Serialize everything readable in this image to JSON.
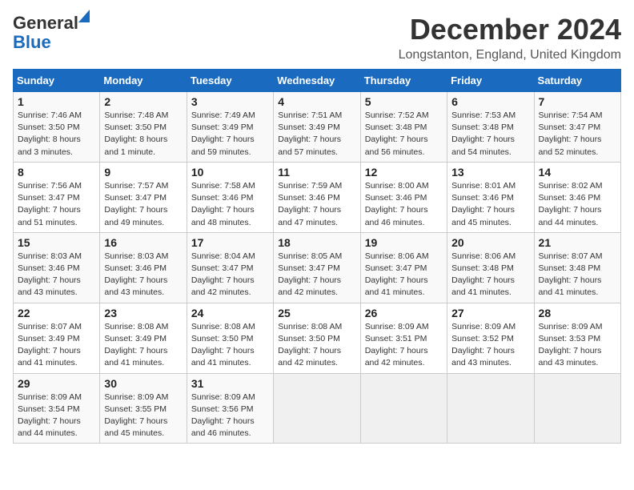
{
  "logo": {
    "line1": "General",
    "line2": "Blue"
  },
  "title": "December 2024",
  "subtitle": "Longstanton, England, United Kingdom",
  "headers": [
    "Sunday",
    "Monday",
    "Tuesday",
    "Wednesday",
    "Thursday",
    "Friday",
    "Saturday"
  ],
  "weeks": [
    [
      {
        "day": "1",
        "info": "Sunrise: 7:46 AM\nSunset: 3:50 PM\nDaylight: 8 hours\nand 3 minutes."
      },
      {
        "day": "2",
        "info": "Sunrise: 7:48 AM\nSunset: 3:50 PM\nDaylight: 8 hours\nand 1 minute."
      },
      {
        "day": "3",
        "info": "Sunrise: 7:49 AM\nSunset: 3:49 PM\nDaylight: 7 hours\nand 59 minutes."
      },
      {
        "day": "4",
        "info": "Sunrise: 7:51 AM\nSunset: 3:49 PM\nDaylight: 7 hours\nand 57 minutes."
      },
      {
        "day": "5",
        "info": "Sunrise: 7:52 AM\nSunset: 3:48 PM\nDaylight: 7 hours\nand 56 minutes."
      },
      {
        "day": "6",
        "info": "Sunrise: 7:53 AM\nSunset: 3:48 PM\nDaylight: 7 hours\nand 54 minutes."
      },
      {
        "day": "7",
        "info": "Sunrise: 7:54 AM\nSunset: 3:47 PM\nDaylight: 7 hours\nand 52 minutes."
      }
    ],
    [
      {
        "day": "8",
        "info": "Sunrise: 7:56 AM\nSunset: 3:47 PM\nDaylight: 7 hours\nand 51 minutes."
      },
      {
        "day": "9",
        "info": "Sunrise: 7:57 AM\nSunset: 3:47 PM\nDaylight: 7 hours\nand 49 minutes."
      },
      {
        "day": "10",
        "info": "Sunrise: 7:58 AM\nSunset: 3:46 PM\nDaylight: 7 hours\nand 48 minutes."
      },
      {
        "day": "11",
        "info": "Sunrise: 7:59 AM\nSunset: 3:46 PM\nDaylight: 7 hours\nand 47 minutes."
      },
      {
        "day": "12",
        "info": "Sunrise: 8:00 AM\nSunset: 3:46 PM\nDaylight: 7 hours\nand 46 minutes."
      },
      {
        "day": "13",
        "info": "Sunrise: 8:01 AM\nSunset: 3:46 PM\nDaylight: 7 hours\nand 45 minutes."
      },
      {
        "day": "14",
        "info": "Sunrise: 8:02 AM\nSunset: 3:46 PM\nDaylight: 7 hours\nand 44 minutes."
      }
    ],
    [
      {
        "day": "15",
        "info": "Sunrise: 8:03 AM\nSunset: 3:46 PM\nDaylight: 7 hours\nand 43 minutes."
      },
      {
        "day": "16",
        "info": "Sunrise: 8:03 AM\nSunset: 3:46 PM\nDaylight: 7 hours\nand 43 minutes."
      },
      {
        "day": "17",
        "info": "Sunrise: 8:04 AM\nSunset: 3:47 PM\nDaylight: 7 hours\nand 42 minutes."
      },
      {
        "day": "18",
        "info": "Sunrise: 8:05 AM\nSunset: 3:47 PM\nDaylight: 7 hours\nand 42 minutes."
      },
      {
        "day": "19",
        "info": "Sunrise: 8:06 AM\nSunset: 3:47 PM\nDaylight: 7 hours\nand 41 minutes."
      },
      {
        "day": "20",
        "info": "Sunrise: 8:06 AM\nSunset: 3:48 PM\nDaylight: 7 hours\nand 41 minutes."
      },
      {
        "day": "21",
        "info": "Sunrise: 8:07 AM\nSunset: 3:48 PM\nDaylight: 7 hours\nand 41 minutes."
      }
    ],
    [
      {
        "day": "22",
        "info": "Sunrise: 8:07 AM\nSunset: 3:49 PM\nDaylight: 7 hours\nand 41 minutes."
      },
      {
        "day": "23",
        "info": "Sunrise: 8:08 AM\nSunset: 3:49 PM\nDaylight: 7 hours\nand 41 minutes."
      },
      {
        "day": "24",
        "info": "Sunrise: 8:08 AM\nSunset: 3:50 PM\nDaylight: 7 hours\nand 41 minutes."
      },
      {
        "day": "25",
        "info": "Sunrise: 8:08 AM\nSunset: 3:50 PM\nDaylight: 7 hours\nand 42 minutes."
      },
      {
        "day": "26",
        "info": "Sunrise: 8:09 AM\nSunset: 3:51 PM\nDaylight: 7 hours\nand 42 minutes."
      },
      {
        "day": "27",
        "info": "Sunrise: 8:09 AM\nSunset: 3:52 PM\nDaylight: 7 hours\nand 43 minutes."
      },
      {
        "day": "28",
        "info": "Sunrise: 8:09 AM\nSunset: 3:53 PM\nDaylight: 7 hours\nand 43 minutes."
      }
    ],
    [
      {
        "day": "29",
        "info": "Sunrise: 8:09 AM\nSunset: 3:54 PM\nDaylight: 7 hours\nand 44 minutes."
      },
      {
        "day": "30",
        "info": "Sunrise: 8:09 AM\nSunset: 3:55 PM\nDaylight: 7 hours\nand 45 minutes."
      },
      {
        "day": "31",
        "info": "Sunrise: 8:09 AM\nSunset: 3:56 PM\nDaylight: 7 hours\nand 46 minutes."
      },
      null,
      null,
      null,
      null
    ]
  ]
}
